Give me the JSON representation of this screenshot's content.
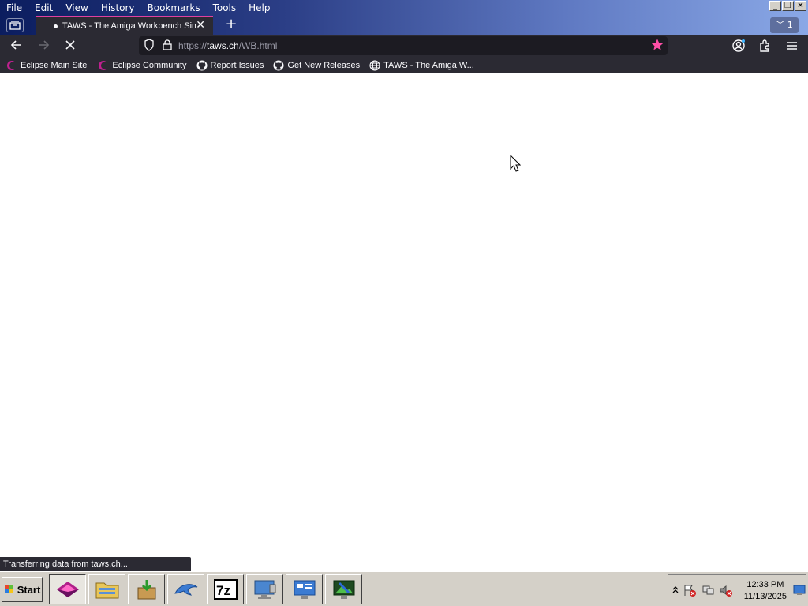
{
  "menu": [
    "File",
    "Edit",
    "View",
    "History",
    "Bookmarks",
    "Tools",
    "Help"
  ],
  "menu_underline": [
    "F",
    "E",
    "V",
    "s",
    "B",
    "T",
    "H"
  ],
  "tab": {
    "title": "TAWS - The Amiga Workbench Simu",
    "close": "✕"
  },
  "tab_counter": "1",
  "url": {
    "prefix": "https://",
    "host": "taws.ch",
    "path": "/WB.html"
  },
  "bookmarks": [
    {
      "label": "Eclipse Main Site",
      "icon": "eclipse-icon"
    },
    {
      "label": "Eclipse Community",
      "icon": "eclipse-icon"
    },
    {
      "label": "Report Issues",
      "icon": "github-icon"
    },
    {
      "label": "Get New Releases",
      "icon": "github-icon"
    },
    {
      "label": "TAWS - The Amiga W...",
      "icon": "globe-icon"
    }
  ],
  "status": "Transferring data from taws.ch...",
  "taskbar": {
    "start": "Start",
    "clock_time": "12:33 PM",
    "clock_date": "11/13/2025"
  },
  "colors": {
    "accent": "#e040a0",
    "browser_chrome": "#2b2a33",
    "star": "#ff4fa7"
  }
}
